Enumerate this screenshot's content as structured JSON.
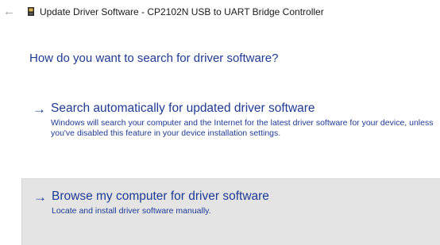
{
  "header": {
    "back_icon": "back-arrow-icon",
    "device_icon": "device-chip-icon",
    "title": "Update Driver Software - CP2102N USB to UART Bridge Controller"
  },
  "main": {
    "heading": "How do you want to search for driver software?",
    "options": [
      {
        "icon": "arrow-right-icon",
        "title": "Search automatically for updated driver software",
        "description": "Windows will search your computer and the Internet for the latest driver software for your device, unless you've disabled this feature in your device installation settings."
      },
      {
        "icon": "arrow-right-icon",
        "title": "Browse my computer for driver software",
        "description": "Locate and install driver software manually.",
        "hovered": true
      }
    ]
  },
  "colors": {
    "link_blue": "#1f3a93",
    "hover_background": "#e4e4e4",
    "title_text": "#1a1a1a",
    "back_arrow": "#9a9a9a"
  }
}
